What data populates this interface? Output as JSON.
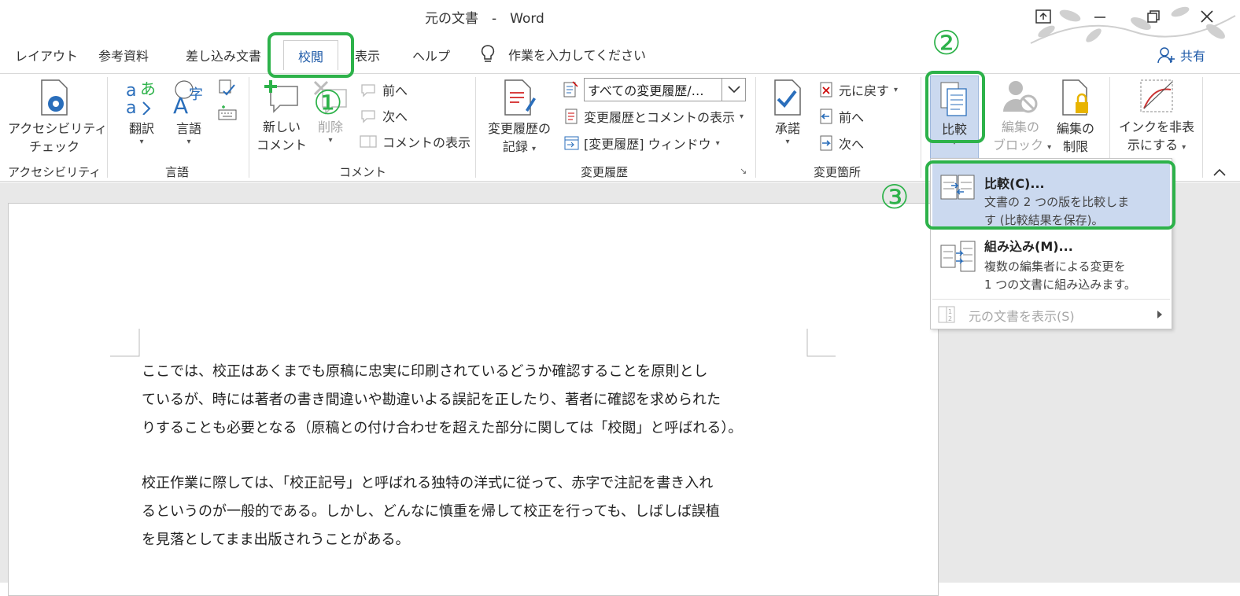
{
  "app": {
    "title": "元の文書　-　Word",
    "window_controls": [
      "ribbon-display-icon",
      "minimize-icon",
      "restore-icon",
      "close-icon"
    ]
  },
  "tabs": [
    {
      "label": "レイアウト"
    },
    {
      "label": "参考資料"
    },
    {
      "label": "差し込み文書"
    },
    {
      "label": "校閲",
      "active": true
    },
    {
      "label": "表示"
    },
    {
      "label": "ヘルプ"
    }
  ],
  "tell_me": {
    "placeholder": "作業を入力してください",
    "icon": "lightbulb-icon"
  },
  "share": {
    "label": "共有",
    "icon": "person-add-icon"
  },
  "ribbon": {
    "accessibility": {
      "check_line1": "アクセシビリティ",
      "check_line2": "チェック",
      "group": "アクセシビリティ"
    },
    "language": {
      "translate": "翻訳",
      "language": "言語",
      "group": "言語"
    },
    "comments": {
      "new_line1": "新しい",
      "new_line2": "コメント",
      "delete": "削除",
      "prev": "前へ",
      "next": "次へ",
      "show": "コメントの表示",
      "group": "コメント"
    },
    "tracking": {
      "track_line1": "変更履歴の",
      "track_line2": "記録",
      "markup_select": "すべての変更履歴/…",
      "show_markup": "変更履歴とコメントの表示",
      "reviewing_pane": "[変更履歴] ウィンドウ",
      "group": "変更履歴"
    },
    "changes": {
      "accept": "承諾",
      "reject": "元に戻す",
      "prev": "前へ",
      "next": "次へ",
      "group": "変更箇所"
    },
    "compare": {
      "label": "比較"
    },
    "protect": {
      "block_line1": "編集の",
      "block_line2": "ブロック",
      "restrict_line1": "編集の",
      "restrict_line2": "制限"
    },
    "ink": {
      "line1": "インクを非表",
      "line2": "示にする"
    }
  },
  "dropdown": {
    "items": [
      {
        "title": "比較(C)...",
        "desc": "文書の 2 つの版を比較しま\nす (比較結果を保存)。",
        "highlighted": true
      },
      {
        "title": "組み込み(M)...",
        "desc": "複数の編集者による変更を\n1 つの文書に組み込みます。"
      },
      {
        "title": "元の文書を表示(S)",
        "disabled": true
      }
    ]
  },
  "document": {
    "paragraph1": [
      "ここでは、校正はあくまでも原稿に忠実に印刷されているどうか確認することを原則とし",
      "ているが、時には著者の書き間違いや勘違いよる誤記を正したり、著者に確認を求められた",
      "りすることも必要となる（原稿との付け合わせを超えた部分に関しては「校閲」と呼ばれる）。"
    ],
    "paragraph2": [
      "校正作業に際しては、「校正記号」と呼ばれる独特の洋式に従って、赤字で注記を書き入れ",
      "るというのが一般的である。しかし、どんなに慎重を帰して校正を行っても、しばしば誤植",
      "を見落としてまま出版されうことがある。"
    ]
  },
  "annotations": {
    "step1": "①",
    "step2": "②",
    "step3": "③"
  },
  "colors": {
    "accent": "#2db24a",
    "ribbon_active": "#1e5aa8",
    "highlight": "#cbd9ef"
  }
}
